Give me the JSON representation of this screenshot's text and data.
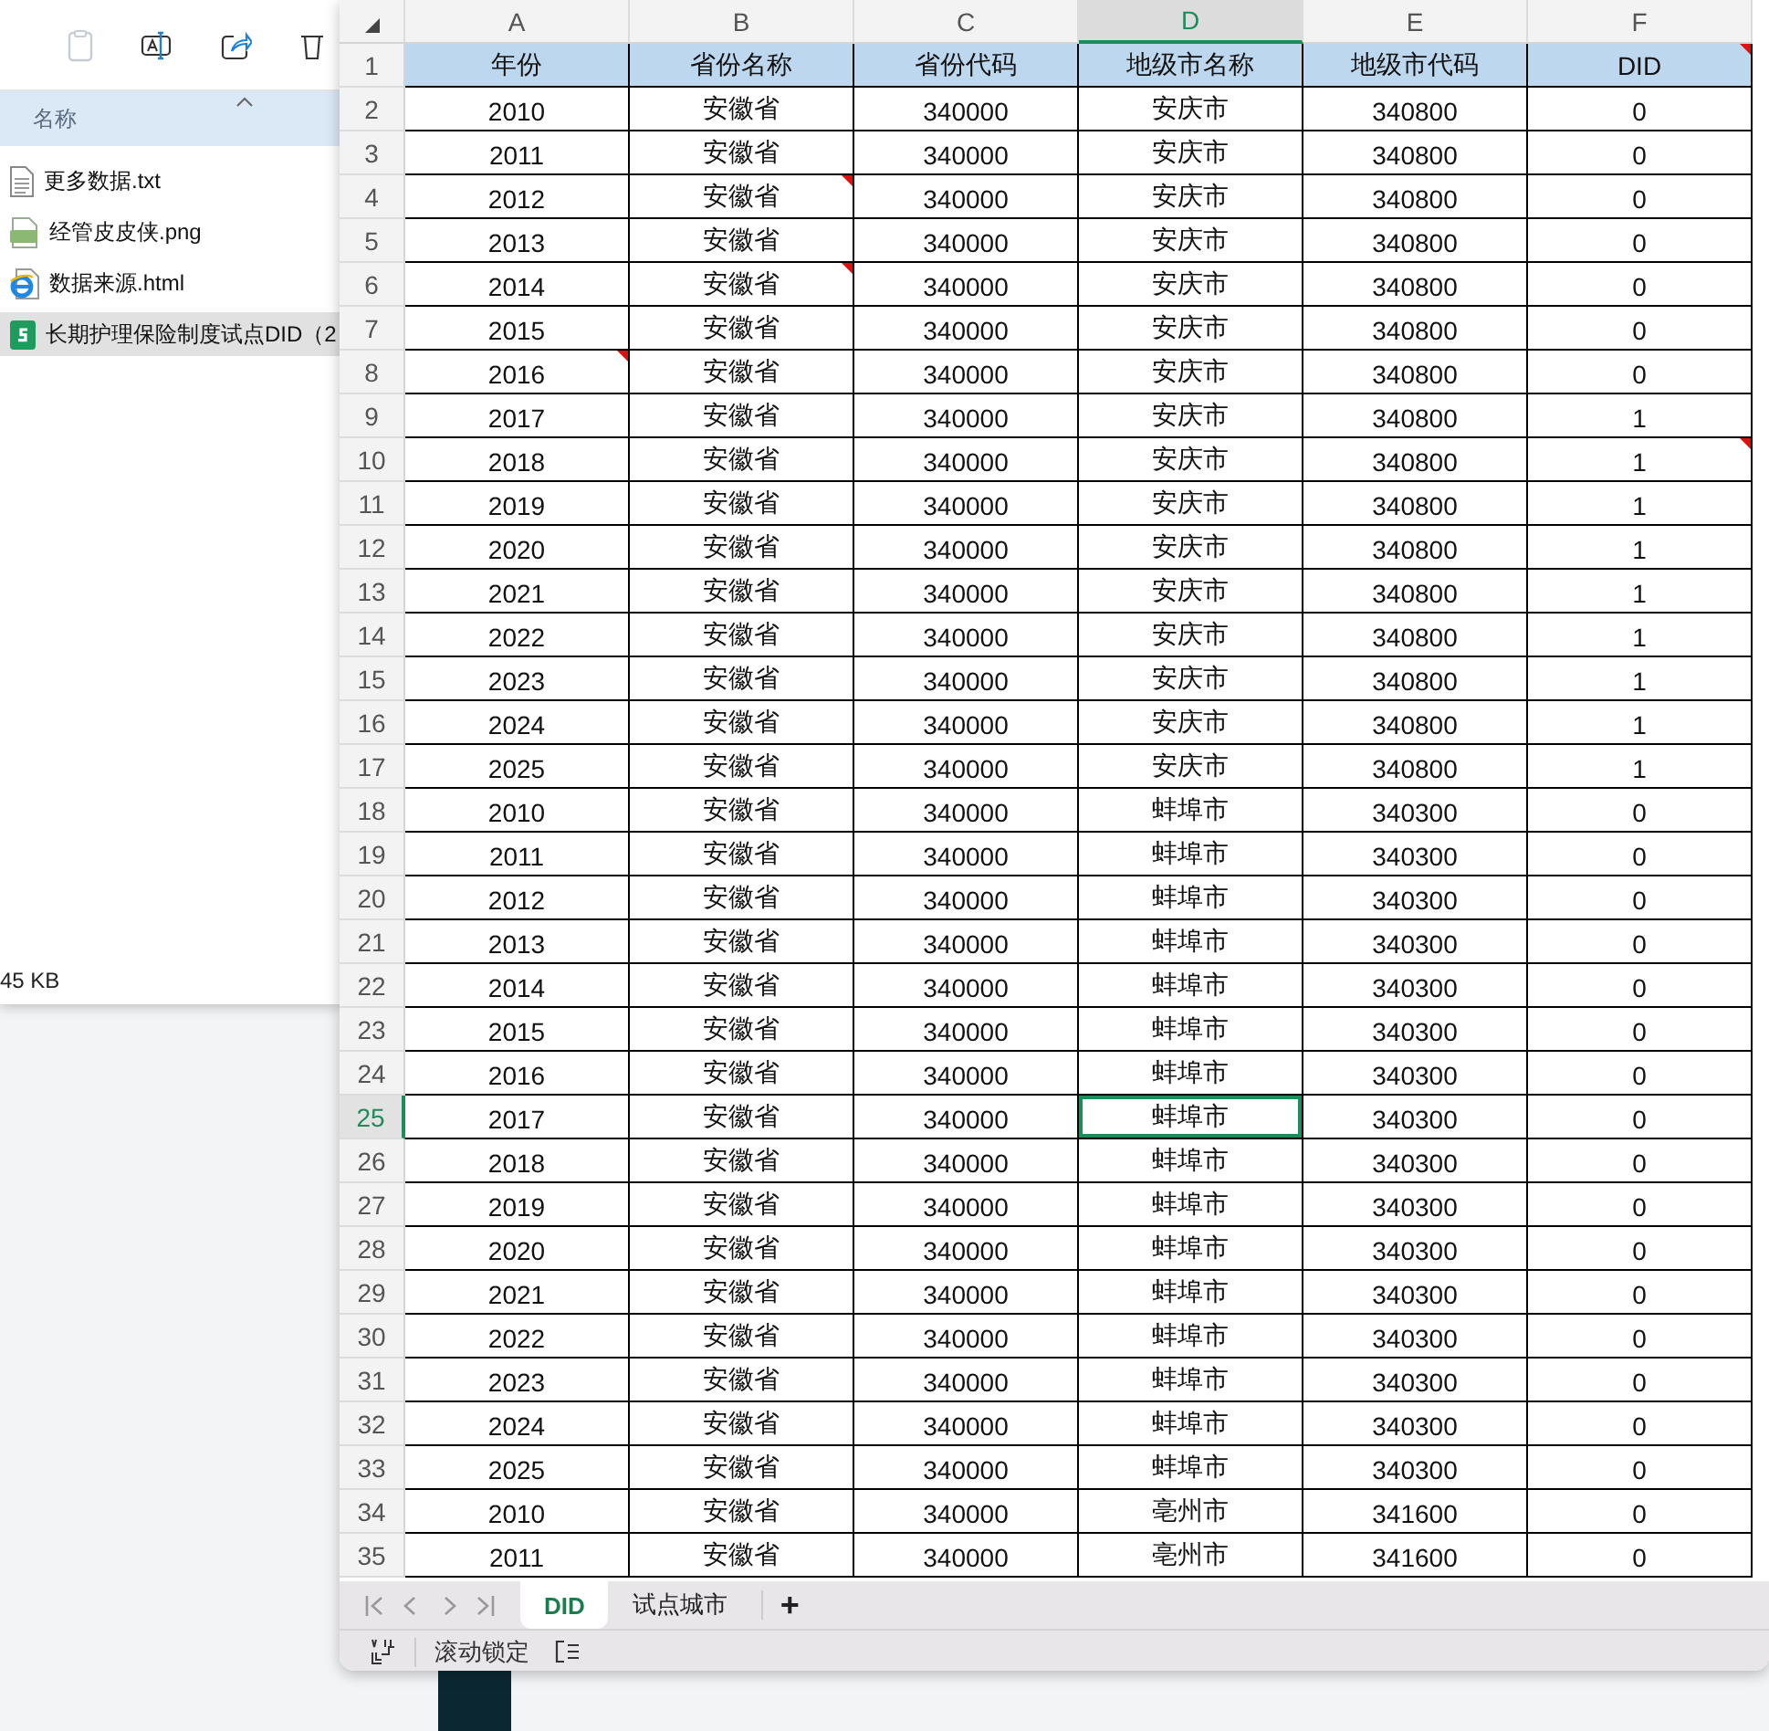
{
  "explorer": {
    "column_header": "名称",
    "files": [
      {
        "name": "更多数据.txt",
        "kind": "text",
        "selected": false
      },
      {
        "name": "经管皮皮侠.png",
        "kind": "image",
        "selected": false
      },
      {
        "name": "数据来源.html",
        "kind": "web",
        "selected": false
      },
      {
        "name": "长期护理保险制度试点DID（2",
        "kind": "sheet",
        "selected": true
      }
    ],
    "status": "45 KB"
  },
  "sheet": {
    "columns": [
      {
        "letter": "A",
        "selected": false
      },
      {
        "letter": "B",
        "selected": false
      },
      {
        "letter": "C",
        "selected": false
      },
      {
        "letter": "D",
        "selected": true
      },
      {
        "letter": "E",
        "selected": false
      },
      {
        "letter": "F",
        "selected": false
      }
    ],
    "rows": [
      {
        "n": "1",
        "kind": "header",
        "selected": false,
        "cells": [
          "年份",
          "省份名称",
          "省份代码",
          "地级市名称",
          "地级市代码",
          "DID"
        ],
        "notes": [
          false,
          false,
          false,
          false,
          false,
          true
        ]
      },
      {
        "n": "2",
        "kind": "data",
        "selected": false,
        "cells": [
          "2010",
          "安徽省",
          "340000",
          "安庆市",
          "340800",
          "0"
        ],
        "notes": [
          false,
          false,
          false,
          false,
          false,
          false
        ]
      },
      {
        "n": "3",
        "kind": "data",
        "selected": false,
        "cells": [
          "2011",
          "安徽省",
          "340000",
          "安庆市",
          "340800",
          "0"
        ],
        "notes": [
          false,
          false,
          false,
          false,
          false,
          false
        ]
      },
      {
        "n": "4",
        "kind": "data",
        "selected": false,
        "cells": [
          "2012",
          "安徽省",
          "340000",
          "安庆市",
          "340800",
          "0"
        ],
        "notes": [
          false,
          true,
          false,
          false,
          false,
          false
        ]
      },
      {
        "n": "5",
        "kind": "data",
        "selected": false,
        "cells": [
          "2013",
          "安徽省",
          "340000",
          "安庆市",
          "340800",
          "0"
        ],
        "notes": [
          false,
          false,
          false,
          false,
          false,
          false
        ]
      },
      {
        "n": "6",
        "kind": "data",
        "selected": false,
        "cells": [
          "2014",
          "安徽省",
          "340000",
          "安庆市",
          "340800",
          "0"
        ],
        "notes": [
          false,
          true,
          false,
          false,
          false,
          false
        ]
      },
      {
        "n": "7",
        "kind": "data",
        "selected": false,
        "cells": [
          "2015",
          "安徽省",
          "340000",
          "安庆市",
          "340800",
          "0"
        ],
        "notes": [
          false,
          false,
          false,
          false,
          false,
          false
        ]
      },
      {
        "n": "8",
        "kind": "data",
        "selected": false,
        "cells": [
          "2016",
          "安徽省",
          "340000",
          "安庆市",
          "340800",
          "0"
        ],
        "notes": [
          true,
          false,
          false,
          false,
          false,
          false
        ]
      },
      {
        "n": "9",
        "kind": "data",
        "selected": false,
        "cells": [
          "2017",
          "安徽省",
          "340000",
          "安庆市",
          "340800",
          "1"
        ],
        "notes": [
          false,
          false,
          false,
          false,
          false,
          false
        ]
      },
      {
        "n": "10",
        "kind": "data",
        "selected": false,
        "cells": [
          "2018",
          "安徽省",
          "340000",
          "安庆市",
          "340800",
          "1"
        ],
        "notes": [
          false,
          false,
          false,
          false,
          false,
          true
        ]
      },
      {
        "n": "11",
        "kind": "data",
        "selected": false,
        "cells": [
          "2019",
          "安徽省",
          "340000",
          "安庆市",
          "340800",
          "1"
        ],
        "notes": [
          false,
          false,
          false,
          false,
          false,
          false
        ]
      },
      {
        "n": "12",
        "kind": "data",
        "selected": false,
        "cells": [
          "2020",
          "安徽省",
          "340000",
          "安庆市",
          "340800",
          "1"
        ],
        "notes": [
          false,
          false,
          false,
          false,
          false,
          false
        ]
      },
      {
        "n": "13",
        "kind": "data",
        "selected": false,
        "cells": [
          "2021",
          "安徽省",
          "340000",
          "安庆市",
          "340800",
          "1"
        ],
        "notes": [
          false,
          false,
          false,
          false,
          false,
          false
        ]
      },
      {
        "n": "14",
        "kind": "data",
        "selected": false,
        "cells": [
          "2022",
          "安徽省",
          "340000",
          "安庆市",
          "340800",
          "1"
        ],
        "notes": [
          false,
          false,
          false,
          false,
          false,
          false
        ]
      },
      {
        "n": "15",
        "kind": "data",
        "selected": false,
        "cells": [
          "2023",
          "安徽省",
          "340000",
          "安庆市",
          "340800",
          "1"
        ],
        "notes": [
          false,
          false,
          false,
          false,
          false,
          false
        ]
      },
      {
        "n": "16",
        "kind": "data",
        "selected": false,
        "cells": [
          "2024",
          "安徽省",
          "340000",
          "安庆市",
          "340800",
          "1"
        ],
        "notes": [
          false,
          false,
          false,
          false,
          false,
          false
        ]
      },
      {
        "n": "17",
        "kind": "data",
        "selected": false,
        "cells": [
          "2025",
          "安徽省",
          "340000",
          "安庆市",
          "340800",
          "1"
        ],
        "notes": [
          false,
          false,
          false,
          false,
          false,
          false
        ]
      },
      {
        "n": "18",
        "kind": "data",
        "selected": false,
        "cells": [
          "2010",
          "安徽省",
          "340000",
          "蚌埠市",
          "340300",
          "0"
        ],
        "notes": [
          false,
          false,
          false,
          false,
          false,
          false
        ]
      },
      {
        "n": "19",
        "kind": "data",
        "selected": false,
        "cells": [
          "2011",
          "安徽省",
          "340000",
          "蚌埠市",
          "340300",
          "0"
        ],
        "notes": [
          false,
          false,
          false,
          false,
          false,
          false
        ]
      },
      {
        "n": "20",
        "kind": "data",
        "selected": false,
        "cells": [
          "2012",
          "安徽省",
          "340000",
          "蚌埠市",
          "340300",
          "0"
        ],
        "notes": [
          false,
          false,
          false,
          false,
          false,
          false
        ]
      },
      {
        "n": "21",
        "kind": "data",
        "selected": false,
        "cells": [
          "2013",
          "安徽省",
          "340000",
          "蚌埠市",
          "340300",
          "0"
        ],
        "notes": [
          false,
          false,
          false,
          false,
          false,
          false
        ]
      },
      {
        "n": "22",
        "kind": "data",
        "selected": false,
        "cells": [
          "2014",
          "安徽省",
          "340000",
          "蚌埠市",
          "340300",
          "0"
        ],
        "notes": [
          false,
          false,
          false,
          false,
          false,
          false
        ]
      },
      {
        "n": "23",
        "kind": "data",
        "selected": false,
        "cells": [
          "2015",
          "安徽省",
          "340000",
          "蚌埠市",
          "340300",
          "0"
        ],
        "notes": [
          false,
          false,
          false,
          false,
          false,
          false
        ]
      },
      {
        "n": "24",
        "kind": "data",
        "selected": false,
        "cells": [
          "2016",
          "安徽省",
          "340000",
          "蚌埠市",
          "340300",
          "0"
        ],
        "notes": [
          false,
          false,
          false,
          false,
          false,
          false
        ]
      },
      {
        "n": "25",
        "kind": "data",
        "selected": true,
        "cells": [
          "2017",
          "安徽省",
          "340000",
          "蚌埠市",
          "340300",
          "0"
        ],
        "notes": [
          false,
          false,
          false,
          false,
          false,
          false
        ]
      },
      {
        "n": "26",
        "kind": "data",
        "selected": false,
        "cells": [
          "2018",
          "安徽省",
          "340000",
          "蚌埠市",
          "340300",
          "0"
        ],
        "notes": [
          false,
          false,
          false,
          false,
          false,
          false
        ]
      },
      {
        "n": "27",
        "kind": "data",
        "selected": false,
        "cells": [
          "2019",
          "安徽省",
          "340000",
          "蚌埠市",
          "340300",
          "0"
        ],
        "notes": [
          false,
          false,
          false,
          false,
          false,
          false
        ]
      },
      {
        "n": "28",
        "kind": "data",
        "selected": false,
        "cells": [
          "2020",
          "安徽省",
          "340000",
          "蚌埠市",
          "340300",
          "0"
        ],
        "notes": [
          false,
          false,
          false,
          false,
          false,
          false
        ]
      },
      {
        "n": "29",
        "kind": "data",
        "selected": false,
        "cells": [
          "2021",
          "安徽省",
          "340000",
          "蚌埠市",
          "340300",
          "0"
        ],
        "notes": [
          false,
          false,
          false,
          false,
          false,
          false
        ]
      },
      {
        "n": "30",
        "kind": "data",
        "selected": false,
        "cells": [
          "2022",
          "安徽省",
          "340000",
          "蚌埠市",
          "340300",
          "0"
        ],
        "notes": [
          false,
          false,
          false,
          false,
          false,
          false
        ]
      },
      {
        "n": "31",
        "kind": "data",
        "selected": false,
        "cells": [
          "2023",
          "安徽省",
          "340000",
          "蚌埠市",
          "340300",
          "0"
        ],
        "notes": [
          false,
          false,
          false,
          false,
          false,
          false
        ]
      },
      {
        "n": "32",
        "kind": "data",
        "selected": false,
        "cells": [
          "2024",
          "安徽省",
          "340000",
          "蚌埠市",
          "340300",
          "0"
        ],
        "notes": [
          false,
          false,
          false,
          false,
          false,
          false
        ]
      },
      {
        "n": "33",
        "kind": "data",
        "selected": false,
        "cells": [
          "2025",
          "安徽省",
          "340000",
          "蚌埠市",
          "340300",
          "0"
        ],
        "notes": [
          false,
          false,
          false,
          false,
          false,
          false
        ]
      },
      {
        "n": "34",
        "kind": "data",
        "selected": false,
        "cells": [
          "2010",
          "安徽省",
          "340000",
          "亳州市",
          "341600",
          "0"
        ],
        "notes": [
          false,
          false,
          false,
          false,
          false,
          false
        ]
      },
      {
        "n": "35",
        "kind": "data",
        "selected": false,
        "cells": [
          "2011",
          "安徽省",
          "340000",
          "亳州市",
          "341600",
          "0"
        ],
        "notes": [
          false,
          false,
          false,
          false,
          false,
          false
        ]
      }
    ],
    "tabs": [
      {
        "label": "DID",
        "selected": true
      },
      {
        "label": "试点城市",
        "selected": false
      }
    ],
    "add_tab": "+",
    "status_text": "滚动锁定"
  }
}
